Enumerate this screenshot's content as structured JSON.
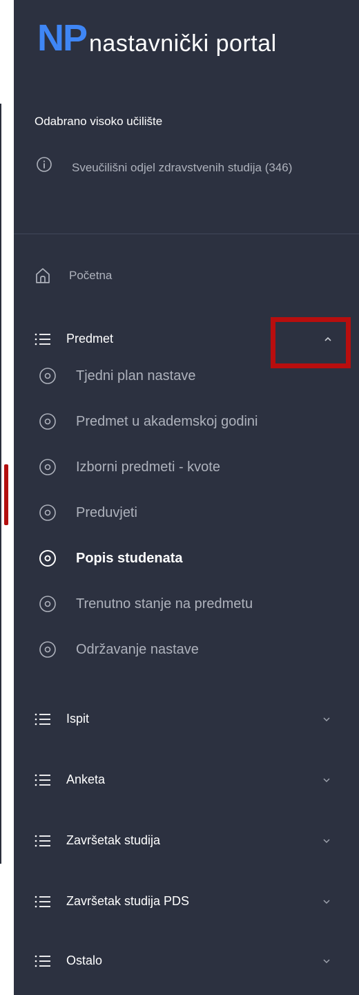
{
  "logo": {
    "mark": "NP",
    "text": "nastavnički portal"
  },
  "institution": {
    "label": "Odabrano visoko učilište",
    "name": "Sveučilišni odjel zdravstvenih studija (346)",
    "icon": "info-circle-icon"
  },
  "nav": {
    "home": {
      "label": "Početna",
      "icon": "home-icon"
    },
    "groups": [
      {
        "label": "Predmet",
        "expanded": true,
        "icon": "list-icon"
      },
      {
        "label": "Ispit",
        "expanded": false,
        "icon": "list-icon"
      },
      {
        "label": "Anketa",
        "expanded": false,
        "icon": "list-icon"
      },
      {
        "label": "Završetak studija",
        "expanded": false,
        "icon": "list-icon"
      },
      {
        "label": "Završetak studija PDS",
        "expanded": false,
        "icon": "list-icon"
      },
      {
        "label": "Ostalo",
        "expanded": false,
        "icon": "list-icon"
      }
    ],
    "predmet_items": [
      {
        "label": "Tjedni plan nastave",
        "active": false
      },
      {
        "label": "Predmet u akademskoj godini",
        "active": false
      },
      {
        "label": "Izborni predmeti - kvote",
        "active": false
      },
      {
        "label": "Preduvjeti",
        "active": false
      },
      {
        "label": "Popis studenata",
        "active": true
      },
      {
        "label": "Trenutno stanje na predmetu",
        "active": false
      },
      {
        "label": "Održavanje nastave",
        "active": false
      }
    ]
  },
  "colors": {
    "sidebar_bg": "#2c3140",
    "accent_blue": "#3f86f5",
    "highlight_red": "#b80e0e",
    "text_muted": "#aeb2bc",
    "text_white": "#ffffff"
  }
}
